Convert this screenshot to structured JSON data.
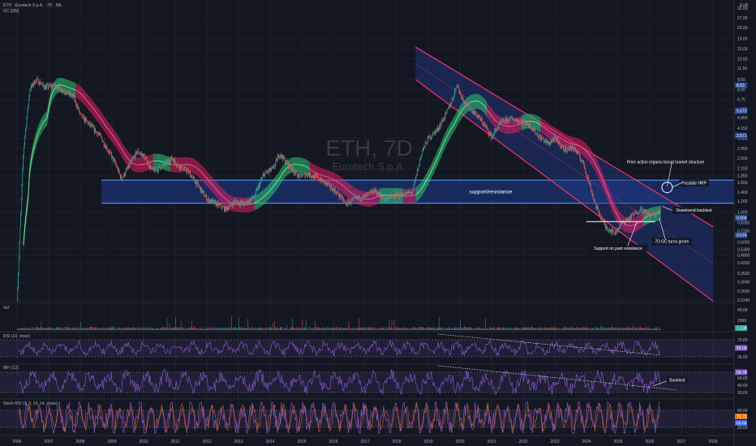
{
  "header": {
    "symbol_line": "ETH · Eurotech S.p.A. · 7D · MIL",
    "indicator_line": "GC [2W]",
    "currency": "EUR"
  },
  "watermark": {
    "ticker": "ETH, 7D",
    "company": "Eurotech S.p.A."
  },
  "colors": {
    "background": "#131722",
    "candle_up": "#26a69a",
    "candle_down": "#ef5350",
    "ribbon_bull": "#2ecc71",
    "ribbon_bear": "#e91e63",
    "zone_fill": "#1e3a8a",
    "zone_border": "#5aa9ff",
    "channel_fill": "#1e3a8a",
    "channel_border": "#ff2e6a",
    "oscillator_line": "#7e57c2"
  },
  "chart_data": {
    "type": "line",
    "title": "ETH, 7D",
    "subtitle": "Eurotech S.p.A.",
    "price_scale": "log",
    "x_years": [
      "2006",
      "2007",
      "2008",
      "2009",
      "2010",
      "2011",
      "2012",
      "2013",
      "2014",
      "2015",
      "2016",
      "2017",
      "2018",
      "2019",
      "2020",
      "2021",
      "2022",
      "2023",
      "2024",
      "2025",
      "2026",
      "2027",
      "2028"
    ],
    "y_ticks": [
      "32.00",
      "27.00",
      "23.00",
      "19.00",
      "16.00",
      "13.50",
      "11.50",
      "9.50",
      "8.00",
      "6.75",
      "5.750",
      "4.950",
      "4.150",
      "3.500",
      "2.950",
      "2.500",
      "2.100",
      "1.850",
      "1.650",
      "1.400",
      "1.200",
      "1.000",
      "0.8350",
      "0.7250",
      "0.6000",
      "0.5300",
      "0.4800",
      "0.4200",
      "0.3520",
      "0.3040",
      "0.2600",
      "0.2240"
    ],
    "price_tags": [
      {
        "label": "8.63",
        "value": 8.63,
        "color": "#2a4a9a"
      },
      {
        "label": "5.573",
        "value": 5.573,
        "color": "#2a4a9a"
      },
      {
        "label": "3.671",
        "value": 3.671,
        "color": "#2a4a9a"
      },
      {
        "label": "0.904",
        "value": 0.904,
        "color": "#2a4a9a"
      },
      {
        "label": "0.674",
        "value": 0.674,
        "color": "#2a4a9a"
      }
    ],
    "price_series": [
      [
        2006.0,
        0.22
      ],
      [
        2006.2,
        2.8
      ],
      [
        2006.4,
        8.0
      ],
      [
        2006.6,
        9.5
      ],
      [
        2006.9,
        8.3
      ],
      [
        2007.2,
        8.6
      ],
      [
        2007.5,
        7.8
      ],
      [
        2007.8,
        7.0
      ],
      [
        2008.0,
        5.2
      ],
      [
        2008.3,
        4.4
      ],
      [
        2008.6,
        3.7
      ],
      [
        2008.9,
        2.8
      ],
      [
        2009.1,
        2.3
      ],
      [
        2009.3,
        1.75
      ],
      [
        2009.5,
        2.1
      ],
      [
        2009.8,
        2.8
      ],
      [
        2010.0,
        2.6
      ],
      [
        2010.3,
        2.0
      ],
      [
        2010.6,
        2.2
      ],
      [
        2010.9,
        2.5
      ],
      [
        2011.1,
        2.2
      ],
      [
        2011.4,
        2.0
      ],
      [
        2011.7,
        1.6
      ],
      [
        2012.0,
        1.25
      ],
      [
        2012.3,
        1.15
      ],
      [
        2012.6,
        1.05
      ],
      [
        2012.9,
        1.2
      ],
      [
        2013.2,
        1.15
      ],
      [
        2013.5,
        1.3
      ],
      [
        2013.8,
        1.9
      ],
      [
        2014.1,
        2.1
      ],
      [
        2014.3,
        2.7
      ],
      [
        2014.6,
        2.2
      ],
      [
        2014.9,
        1.85
      ],
      [
        2015.2,
        1.9
      ],
      [
        2015.5,
        1.8
      ],
      [
        2015.8,
        1.6
      ],
      [
        2016.1,
        1.4
      ],
      [
        2016.4,
        1.15
      ],
      [
        2016.7,
        1.25
      ],
      [
        2017.0,
        1.3
      ],
      [
        2017.3,
        1.45
      ],
      [
        2017.6,
        1.25
      ],
      [
        2017.9,
        1.3
      ],
      [
        2018.2,
        1.35
      ],
      [
        2018.5,
        1.4
      ],
      [
        2018.8,
        2.8
      ],
      [
        2019.0,
        3.5
      ],
      [
        2019.3,
        4.1
      ],
      [
        2019.6,
        5.5
      ],
      [
        2019.8,
        7.2
      ],
      [
        2019.9,
        8.9
      ],
      [
        2020.0,
        7.6
      ],
      [
        2020.2,
        6.2
      ],
      [
        2020.4,
        5.6
      ],
      [
        2020.6,
        5.0
      ],
      [
        2020.8,
        4.3
      ],
      [
        2021.0,
        3.6
      ],
      [
        2021.3,
        4.6
      ],
      [
        2021.6,
        4.9
      ],
      [
        2021.9,
        4.7
      ],
      [
        2022.2,
        4.4
      ],
      [
        2022.5,
        3.6
      ],
      [
        2022.8,
        3.2
      ],
      [
        2023.0,
        3.5
      ],
      [
        2023.3,
        2.9
      ],
      [
        2023.6,
        3.0
      ],
      [
        2023.9,
        2.3
      ],
      [
        2024.1,
        1.6
      ],
      [
        2024.3,
        1.1
      ],
      [
        2024.6,
        0.78
      ],
      [
        2024.9,
        0.7
      ],
      [
        2025.1,
        0.82
      ],
      [
        2025.4,
        0.92
      ],
      [
        2025.7,
        1.05
      ],
      [
        2026.0,
        0.95
      ],
      [
        2026.2,
        0.97
      ],
      [
        2026.35,
        1.05
      ]
    ],
    "support_resistance_zone": {
      "label": "support/resistance",
      "upper": 1.72,
      "lower": 1.16
    },
    "channel": {
      "start_year": 2018.6,
      "end_year": 2028.0,
      "upper_start": 16.5,
      "upper_end": 0.78,
      "lower_start": 9.5,
      "lower_end": 0.22,
      "mid_start": 12.5,
      "mid_end": 0.42
    },
    "annotations": [
      {
        "label": "Price action regains broad market structure",
        "year": 2026.5,
        "value": 2.35
      },
      {
        "label": "Possible HRP",
        "year": 2027.4,
        "value": 1.64
      },
      {
        "label": "Downtrend backtest",
        "year": 2027.4,
        "value": 1.03
      },
      {
        "label": "7D GC turns green",
        "year": 2026.7,
        "value": 0.605
      },
      {
        "label": "Support on past resistance",
        "year": 2025.0,
        "value": 0.54
      }
    ],
    "volume_pane": {
      "label": "Vol",
      "tags": [
        {
          "label": "40.6K"
        },
        {
          "label": "1.13K"
        }
      ],
      "ticks": [
        "206K",
        "40.6K"
      ]
    },
    "rsi_pane": {
      "label": "RSI (14, close)",
      "ticks": [
        "70.00",
        "55.00",
        "25.00"
      ],
      "tag": "55.00"
    },
    "mfi_pane": {
      "label": "MFI (12)",
      "ticks": [
        "80.00",
        "60.00",
        "40.00",
        "20.00"
      ],
      "tag": "59.78",
      "annotation": "Backtest"
    },
    "stoch_pane": {
      "label": "Stoch RSI (3, 3, 14, 14, close)",
      "ticks": [
        "80.00",
        "20.00"
      ],
      "tags": [
        "76.70",
        "68.68"
      ]
    }
  }
}
